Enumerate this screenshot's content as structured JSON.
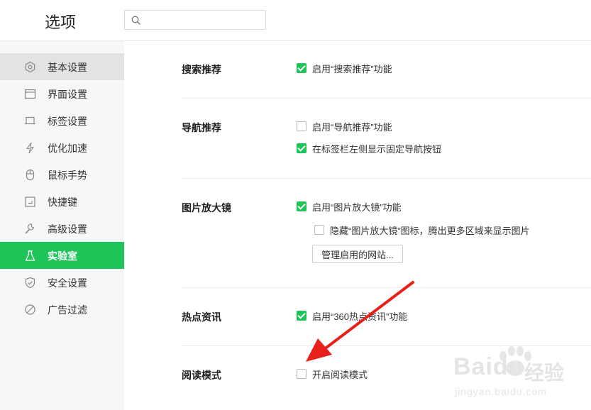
{
  "header": {
    "title": "选项",
    "search_placeholder": "",
    "search_value": ""
  },
  "sidebar": {
    "items": [
      {
        "label": "基本设置",
        "icon": "gear-icon"
      },
      {
        "label": "界面设置",
        "icon": "window-icon"
      },
      {
        "label": "标签设置",
        "icon": "tab-icon"
      },
      {
        "label": "优化加速",
        "icon": "lightning-icon"
      },
      {
        "label": "鼠标手势",
        "icon": "mouse-icon"
      },
      {
        "label": "快捷键",
        "icon": "shortcut-icon"
      },
      {
        "label": "高级设置",
        "icon": "wrench-icon"
      },
      {
        "label": "实验室",
        "icon": "flask-icon"
      },
      {
        "label": "安全设置",
        "icon": "shield-icon"
      },
      {
        "label": "广告过滤",
        "icon": "block-icon"
      }
    ],
    "active": "实验室",
    "hovered": "基本设置"
  },
  "sections": {
    "search": {
      "title": "搜索推荐",
      "options": [
        {
          "label": "启用“搜索推荐”功能",
          "checked": true
        }
      ]
    },
    "nav": {
      "title": "导航推荐",
      "options": [
        {
          "label": "启用“导航推荐”功能",
          "checked": false
        },
        {
          "label": "在标签栏左侧显示固定导航按钮",
          "checked": true
        }
      ]
    },
    "magnifier": {
      "title": "图片放大镜",
      "options": [
        {
          "label": "启用“图片放大镜”功能",
          "checked": true
        },
        {
          "label": "隐藏“图片放大镜”图标，腾出更多区域来显示图片",
          "checked": false
        }
      ],
      "button_label": "管理启用的网站..."
    },
    "news": {
      "title": "热点资讯",
      "options": [
        {
          "label": "启用“360热点资讯”功能",
          "checked": true
        }
      ]
    },
    "reading": {
      "title": "阅读模式",
      "options": [
        {
          "label": "开启阅读模式",
          "checked": false
        }
      ]
    }
  },
  "colors": {
    "accent": "#1dc457",
    "arrow": "#e8201a",
    "sidebar_bg": "#f7f7f7"
  },
  "watermark": {
    "brand": "Baidu",
    "cn": "经验",
    "url": "jingyan.baidu.com"
  }
}
